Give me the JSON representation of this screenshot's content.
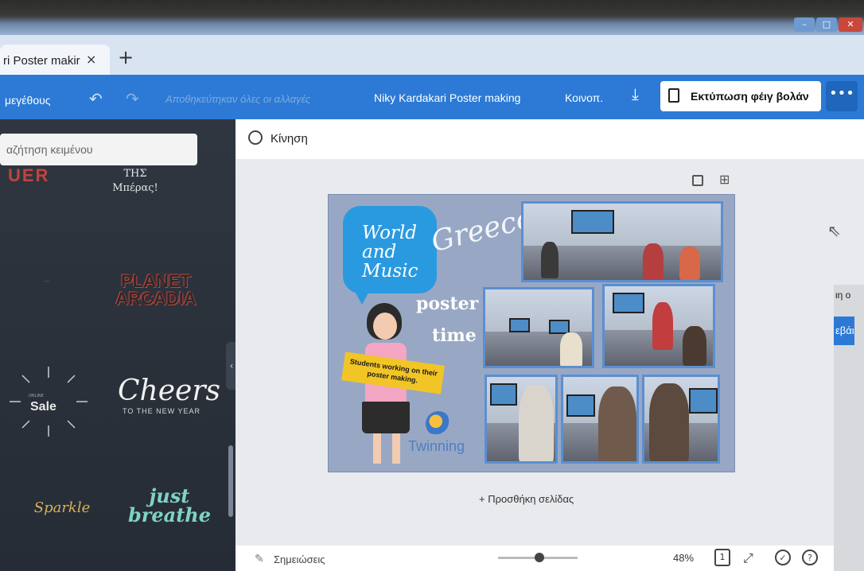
{
  "window": {
    "min_label": "–",
    "max_label": "□",
    "close_label": "✕"
  },
  "browser": {
    "tab_title": "ri Poster makir",
    "tab_close": "×",
    "new_tab": "+"
  },
  "toolbar": {
    "resize_label": "μεγέθους",
    "undo_icon": "↶",
    "redo_icon": "↷",
    "saved_status": "Αποθηκεύτηκαν όλες οι αλλαγές",
    "document_title": "Niky Kardakari Poster making",
    "share_label": "Κοινοπ.",
    "download_icon": "⤓",
    "print_label": "Εκτύπωση φέιγ βολάν",
    "more_label": "•••"
  },
  "sidepanel": {
    "search_placeholder": "αζήτηση κειμένου",
    "collapse_icon": "‹",
    "templates": {
      "t1": "UER",
      "t2_line1": "ΤΗΣ",
      "t2_line2": "Μπέρας!",
      "t3": "...",
      "t4_line1": "PLANET",
      "t4_line2": "ARCADIA",
      "t5_title": "Sale",
      "t5_sub": "ONLINE",
      "t6_title": "Cheers",
      "t6_sub": "TO THE NEW YEAR",
      "t7": "Sparkle",
      "t8_line1": "just",
      "t8_line2": "breathe"
    }
  },
  "workspace": {
    "motion_label": "Κίνηση",
    "add_page_label": "+ Προσθήκη σελίδας",
    "notes_label": "Σημειώσεις",
    "zoom_value": "48%",
    "page_count": "1",
    "zoom_fraction": 0.48
  },
  "poster": {
    "speech_line1": "World",
    "speech_line2": "and",
    "speech_line3": "Music",
    "greece": "Greece",
    "word_1": "poster",
    "word_2": "time",
    "caption": "Students working on their poster making.",
    "logo_text": "Twinning"
  },
  "other_window": {
    "text": "ιη ο",
    "bar_text": "εβάι"
  }
}
